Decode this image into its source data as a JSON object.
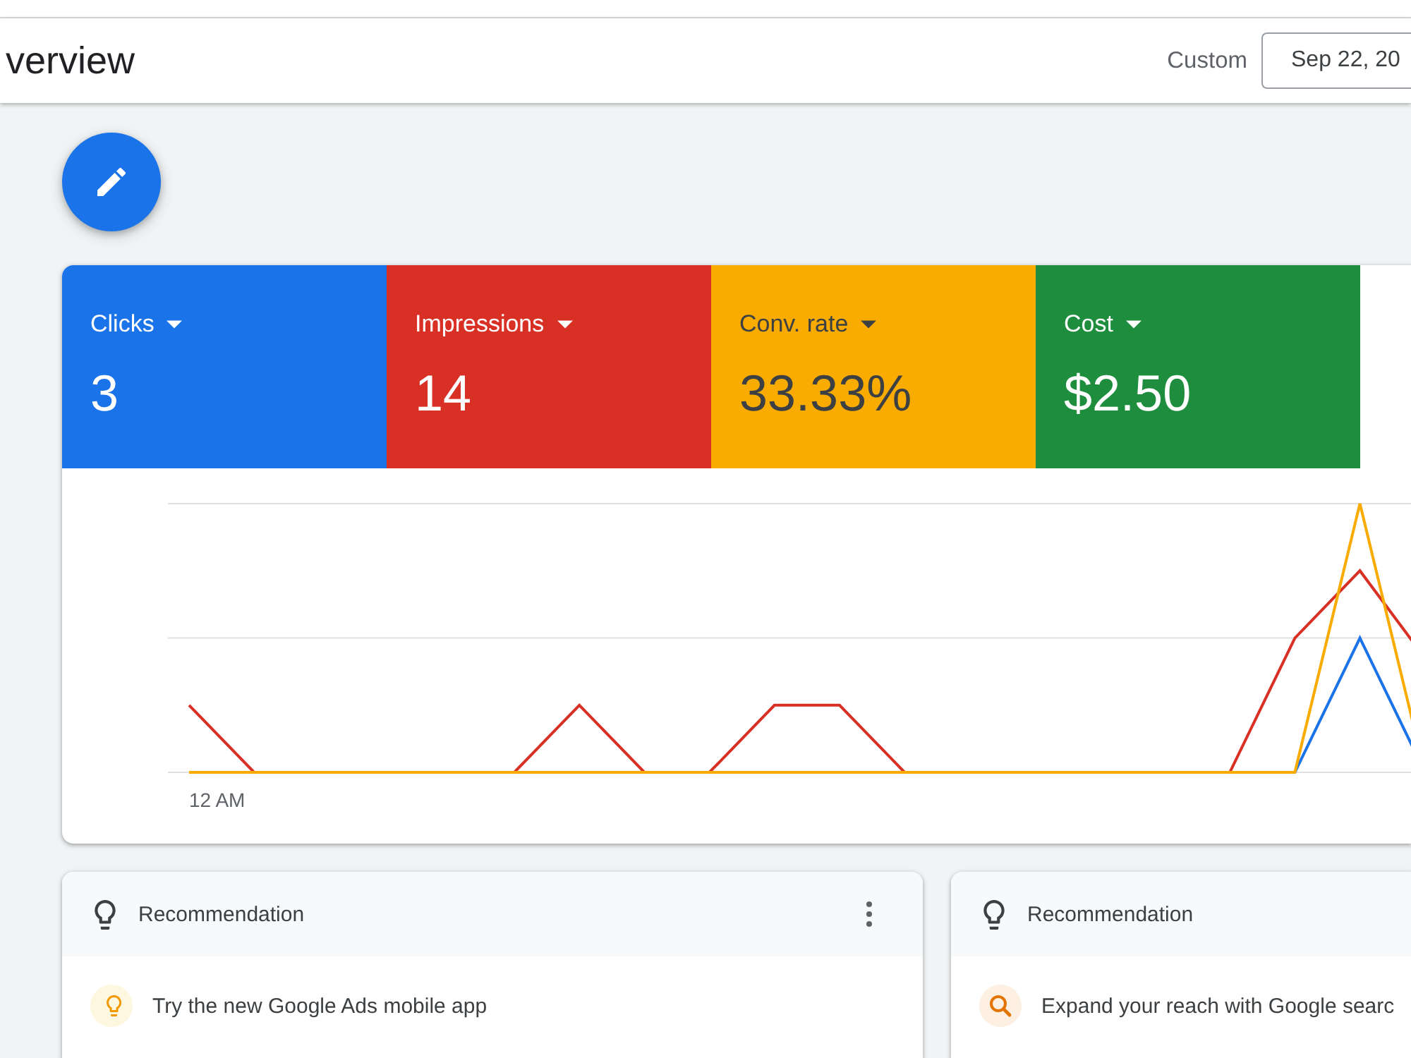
{
  "header": {
    "title": "verview",
    "range_label": "Custom",
    "date_range": "Sep 22, 20"
  },
  "metrics": [
    {
      "label": "Clicks",
      "value": "3",
      "color": "#1a73e8"
    },
    {
      "label": "Impressions",
      "value": "14",
      "color": "#d93025"
    },
    {
      "label": "Conv. rate",
      "value": "33.33%",
      "color": "#f9ab00"
    },
    {
      "label": "Cost",
      "value": "$2.50",
      "color": "#1e8e3e"
    }
  ],
  "chart": {
    "axis_label": "12 AM"
  },
  "recommendations": [
    {
      "header": "Recommendation",
      "menu": true,
      "kind": "bulb",
      "text": "Try the new Google Ads mobile app"
    },
    {
      "header": "Recommendation",
      "menu": false,
      "kind": "search",
      "text": "Expand your reach with Google searc"
    }
  ]
}
